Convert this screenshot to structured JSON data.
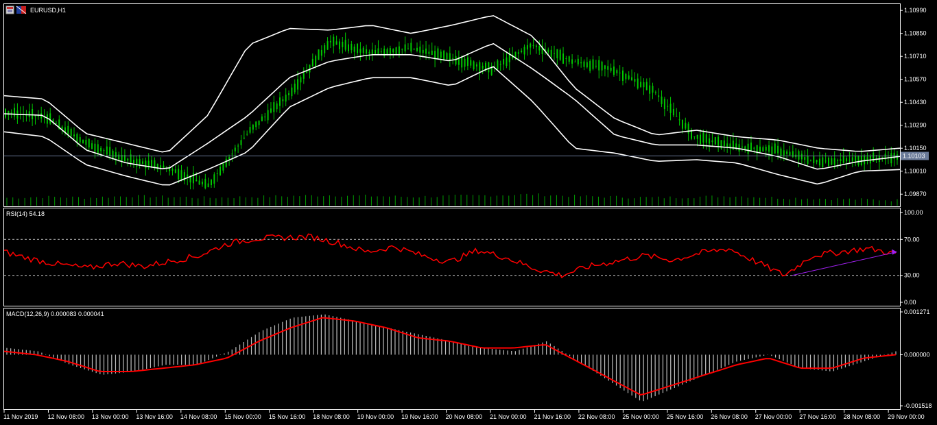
{
  "header": {
    "symbol_title": "EURUSD,H1"
  },
  "indicators": {
    "rsi_label": "RSI(14) 54.18",
    "macd_label": "MACD(12,26,9) 0.000083 0.000041"
  },
  "colors": {
    "background": "#000000",
    "frame": "#ffffff",
    "candle": "#00c800",
    "bands": "#ffffff",
    "volume": "#00a000",
    "rsi_line": "#ff0000",
    "rsi_trend": "#a020f0",
    "macd_hist": "#c0c0c0",
    "macd_signal": "#ff0000",
    "price_line": "#6a7a98"
  },
  "icons": [
    "chart-window-icon",
    "chart-flag-icon"
  ],
  "chart_data": [
    {
      "type": "candlestick",
      "title": "EURUSD,H1",
      "ylim": [
        1.098,
        1.1102
      ],
      "yticks": [
        "1.10990",
        "1.10850",
        "1.10710",
        "1.10570",
        "1.10430",
        "1.10290",
        "1.10150",
        "1.10010",
        "1.09870"
      ],
      "current_price": "1.10103",
      "x": [
        "11 Nov 2019",
        "12 Nov 08:00",
        "13 Nov 00:00",
        "13 Nov 16:00",
        "14 Nov 08:00",
        "15 Nov 00:00",
        "15 Nov 16:00",
        "18 Nov 08:00",
        "19 Nov 00:00",
        "19 Nov 16:00",
        "20 Nov 08:00",
        "21 Nov 00:00",
        "21 Nov 16:00",
        "22 Nov 08:00",
        "25 Nov 00:00",
        "25 Nov 16:00",
        "26 Nov 08:00",
        "27 Nov 00:00",
        "27 Nov 16:00",
        "28 Nov 08:00",
        "29 Nov 00:00"
      ],
      "close": [
        1.1037,
        1.1034,
        1.1018,
        1.1008,
        1.1003,
        1.0992,
        1.1025,
        1.1048,
        1.108,
        1.1073,
        1.1076,
        1.107,
        1.1063,
        1.1078,
        1.1068,
        1.1063,
        1.105,
        1.1022,
        1.1016,
        1.1014,
        1.1007,
        1.1008,
        1.101
      ],
      "bollinger": {
        "upper": [
          1.1047,
          1.1045,
          1.1024,
          1.1018,
          1.1012,
          1.1035,
          1.1078,
          1.1088,
          1.1087,
          1.109,
          1.1085,
          1.109,
          1.1096,
          1.1083,
          1.1052,
          1.1033,
          1.1023,
          1.1026,
          1.1022,
          1.102,
          1.1015,
          1.1013,
          1.1015
        ],
        "middle": [
          1.1036,
          1.1035,
          1.1014,
          1.1006,
          1.1002,
          1.1018,
          1.1035,
          1.1058,
          1.1068,
          1.1072,
          1.1072,
          1.1068,
          1.1079,
          1.1063,
          1.1045,
          1.1023,
          1.1017,
          1.1017,
          1.1015,
          1.101,
          1.1002,
          1.1007,
          1.101
        ],
        "lower": [
          1.1025,
          1.1022,
          1.1005,
          1.0998,
          1.0992,
          1.1002,
          1.1013,
          1.104,
          1.1052,
          1.1058,
          1.1058,
          1.1053,
          1.1065,
          1.1043,
          1.1015,
          1.1012,
          1.1007,
          1.1008,
          1.1006,
          1.0999,
          1.0993,
          1.1001,
          1.1002
        ]
      },
      "volume": [
        8,
        9,
        8,
        10,
        9,
        8,
        9,
        10,
        11,
        10,
        9,
        10,
        11,
        12,
        10,
        9,
        8,
        9,
        10,
        8,
        7,
        6,
        5
      ]
    },
    {
      "type": "line",
      "title": "RSI(14) 54.18",
      "ylim": [
        0,
        100
      ],
      "yticks": [
        "100.00",
        "70.00",
        "30.00",
        "0.00"
      ],
      "levels": [
        70,
        30
      ],
      "values": [
        56,
        48,
        42,
        38,
        44,
        40,
        46,
        52,
        65,
        71,
        72,
        73,
        66,
        56,
        62,
        52,
        45,
        58,
        50,
        38,
        30,
        40,
        46,
        52,
        47,
        55,
        60,
        45,
        30,
        52,
        56,
        60,
        54
      ],
      "trendline": {
        "from": 30,
        "to": 56
      }
    },
    {
      "type": "bar",
      "title": "MACD(12,26,9) 0.000083 0.000041",
      "ylim": [
        -0.001518,
        0.001271
      ],
      "yticks": [
        "0.001271",
        "0.000000",
        "-0.001518"
      ],
      "histogram": [
        0.0002,
        0.0001,
        -0.0003,
        -0.0006,
        -0.0005,
        -0.0003,
        -0.0003,
        0.0001,
        0.0007,
        0.0011,
        0.0012,
        0.001,
        0.0008,
        0.0006,
        0.0004,
        0.0002,
        0.0001,
        0.0004,
        -0.0002,
        -0.0008,
        -0.0014,
        -0.001,
        -0.0006,
        -0.0002,
        0.0,
        -0.0004,
        -0.0005,
        -0.0002,
        0.0001
      ],
      "signal": [
        0.0001,
        0.0,
        -0.0002,
        -0.0005,
        -0.0005,
        -0.0004,
        -0.0003,
        -0.0001,
        0.0004,
        0.0008,
        0.0011,
        0.001,
        0.0008,
        0.0005,
        0.0004,
        0.0002,
        0.0002,
        0.0003,
        -0.0002,
        -0.0007,
        -0.0012,
        -0.0009,
        -0.0006,
        -0.0003,
        -0.0001,
        -0.0004,
        -0.0004,
        -0.0001,
        0.0
      ]
    }
  ]
}
